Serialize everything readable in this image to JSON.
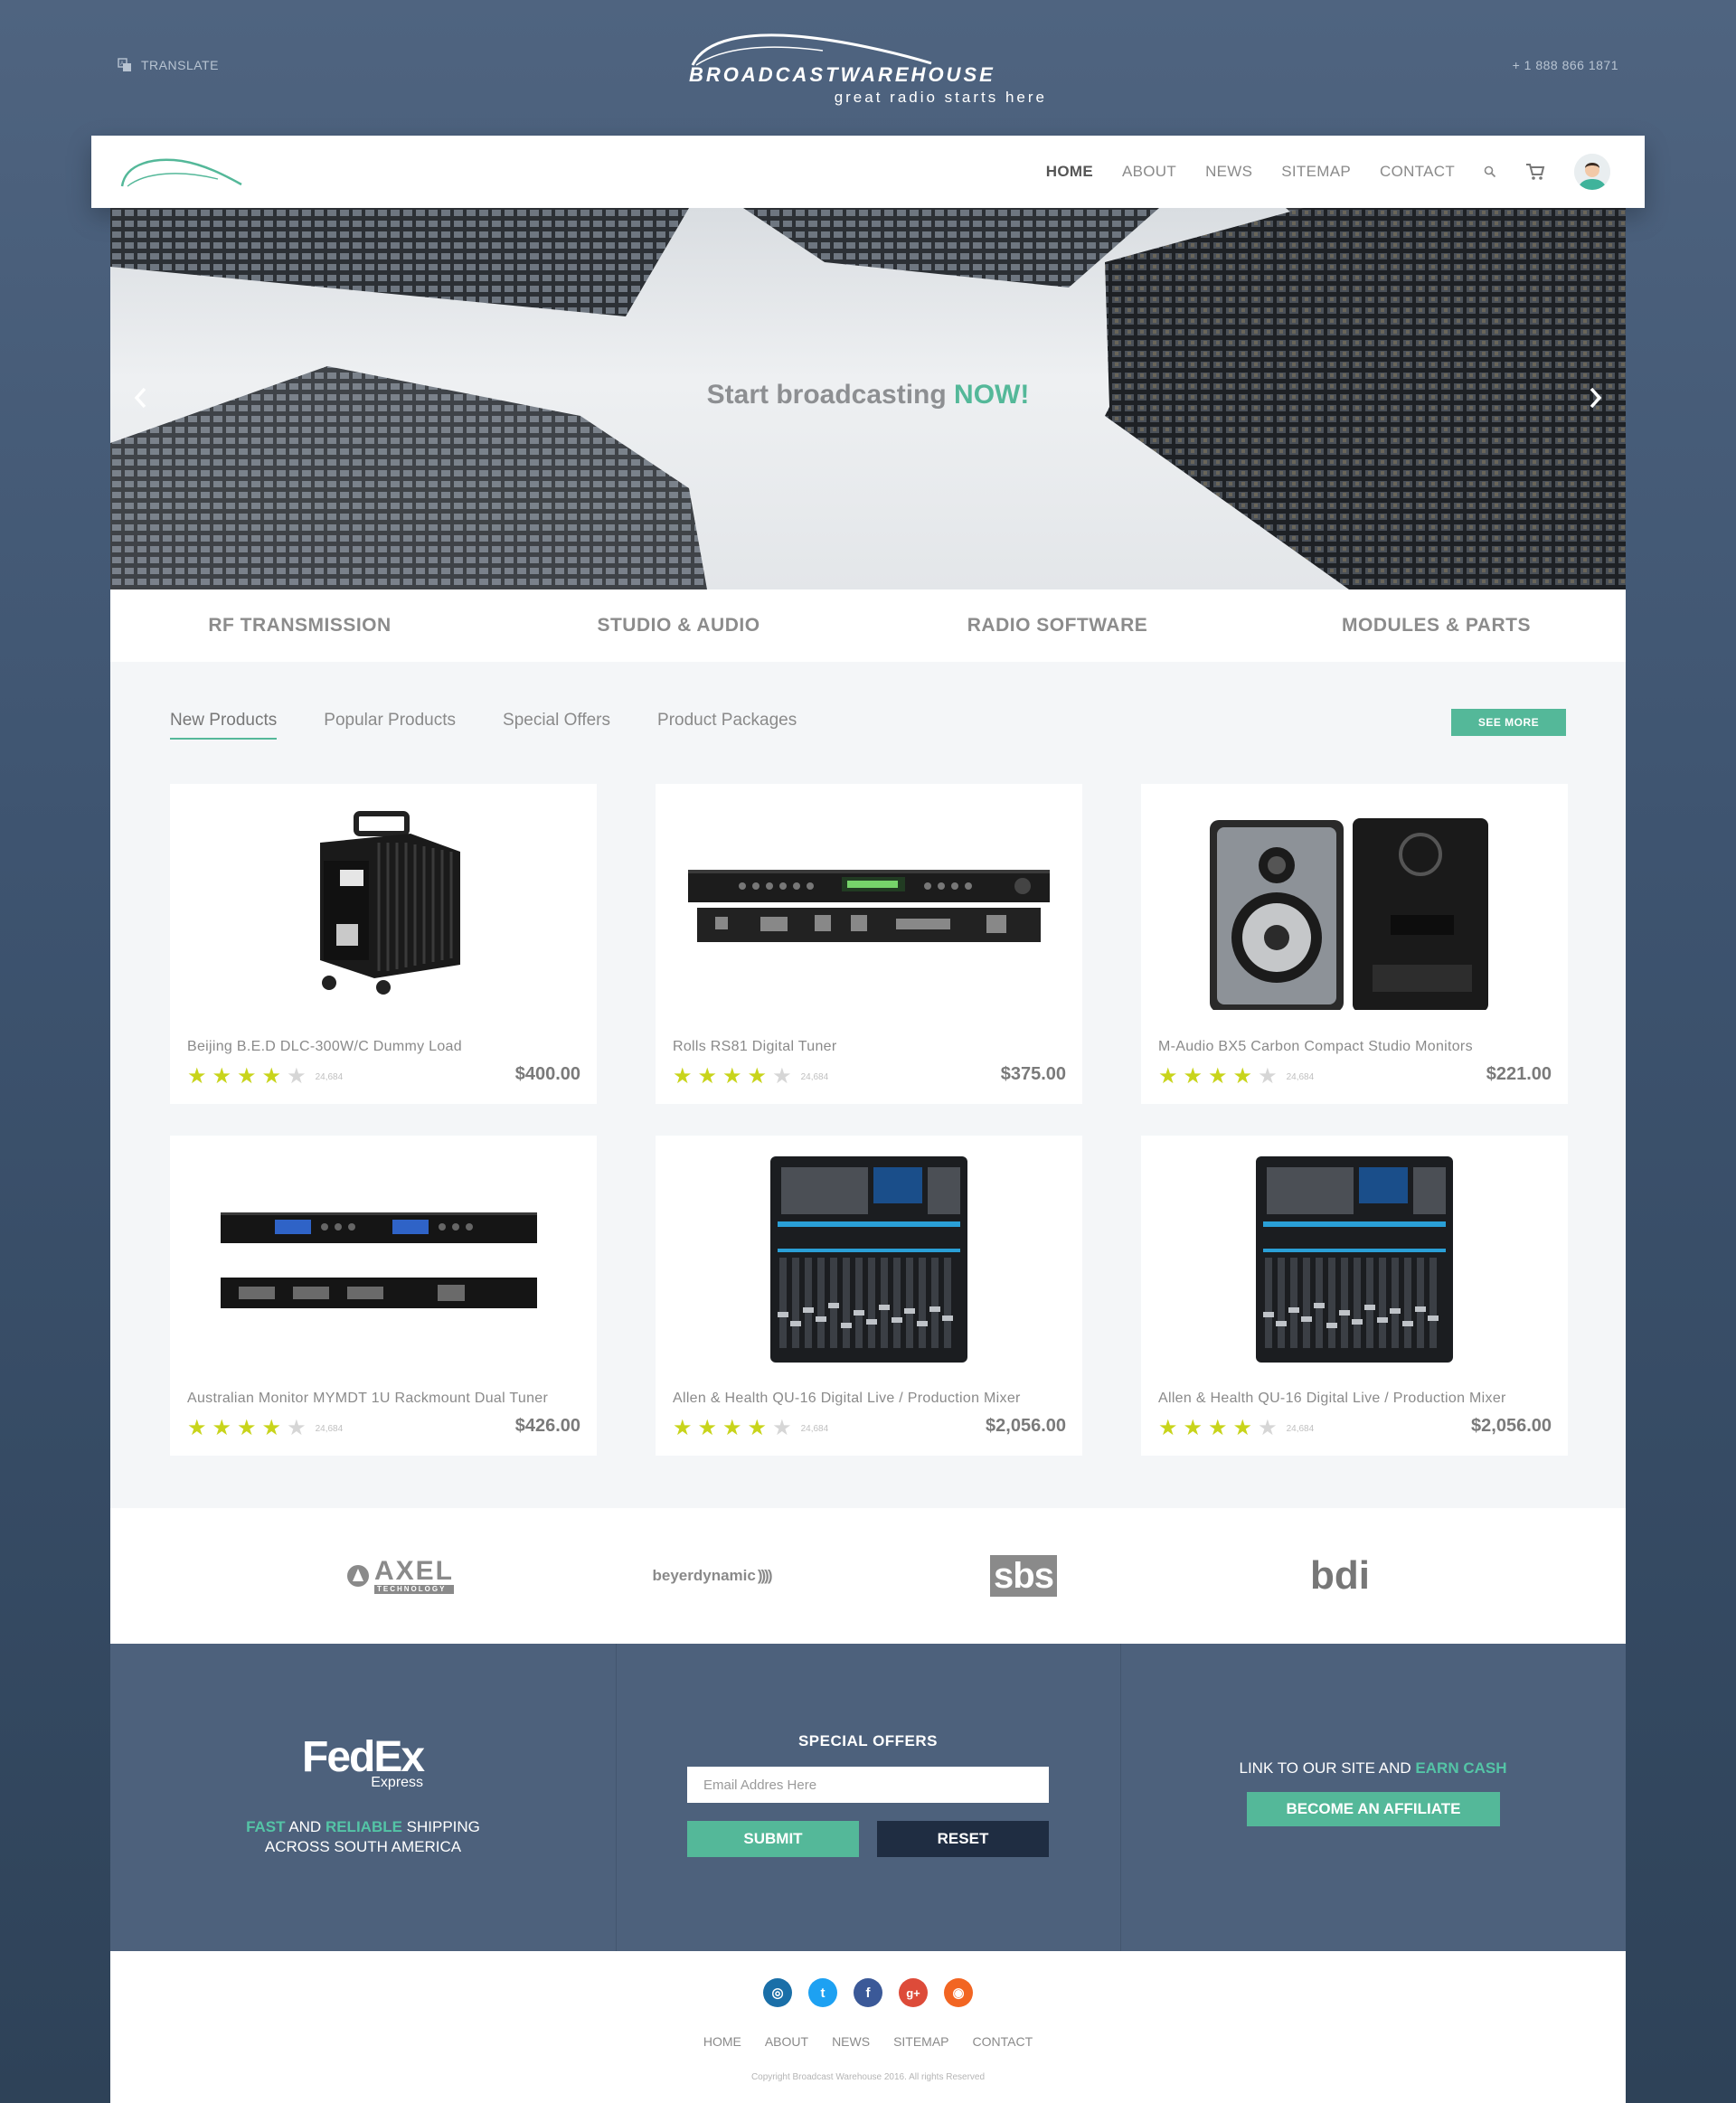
{
  "topbar": {
    "translate_icon": "translate-icon",
    "translate_label": "TRANSLATE",
    "phone": "+ 1 888 866 1871",
    "brand_name": "BROADCASTWAREHOUSE",
    "brand_tagline": "great radio starts here"
  },
  "nav": {
    "items": [
      {
        "label": "HOME",
        "active": true
      },
      {
        "label": "ABOUT",
        "active": false
      },
      {
        "label": "NEWS",
        "active": false
      },
      {
        "label": "SITEMAP",
        "active": false
      },
      {
        "label": "CONTACT",
        "active": false
      }
    ],
    "search_icon": "search-icon",
    "cart_icon": "cart-icon",
    "avatar_icon": "user-avatar"
  },
  "hero": {
    "title_prefix": "Start broadcasting ",
    "title_accent": "NOW!",
    "prev_icon": "chevron-left-icon",
    "next_icon": "chevron-right-icon"
  },
  "categories": [
    "RF TRANSMISSION",
    "STUDIO & AUDIO",
    "RADIO SOFTWARE",
    "MODULES & PARTS"
  ],
  "products_section": {
    "tabs": [
      "New Products",
      "Popular Products",
      "Special Offers",
      "Product Packages"
    ],
    "active_tab": "New Products",
    "see_more_label": "SEE MORE"
  },
  "products": [
    {
      "name": "Beijing B.E.D DLC-300W/C Dummy Load",
      "price": "$400.00",
      "rating": 4,
      "reviews": "24,684",
      "image": "dummy-load"
    },
    {
      "name": "Rolls RS81 Digital Tuner",
      "price": "$375.00",
      "rating": 4,
      "reviews": "24,684",
      "image": "rack-tuner"
    },
    {
      "name": "M-Audio BX5 Carbon Compact Studio Monitors",
      "price": "$221.00",
      "rating": 4,
      "reviews": "24,684",
      "image": "studio-monitors"
    },
    {
      "name": "Australian Monitor MYMDT 1U Rackmount Dual Tuner",
      "price": "$426.00",
      "rating": 4,
      "reviews": "24,684",
      "image": "rack-dual-tuner"
    },
    {
      "name": "Allen & Health QU-16 Digital Live / Production Mixer",
      "price": "$2,056.00",
      "rating": 4,
      "reviews": "24,684",
      "image": "mixer"
    },
    {
      "name": "Allen & Health QU-16 Digital Live / Production Mixer",
      "price": "$2,056.00",
      "rating": 4,
      "reviews": "24,684",
      "image": "mixer"
    }
  ],
  "brands": [
    {
      "name": "AXEL",
      "sub": "TECHNOLOGY"
    },
    {
      "name": "beyerdynamic",
      "sub": ""
    },
    {
      "name": "sbs",
      "sub": ""
    },
    {
      "name": "bdi",
      "sub": ""
    }
  ],
  "footer": {
    "fedex_logo": "FedEx",
    "fedex_sub": "Express",
    "shipping_fast": "FAST",
    "shipping_and": " AND ",
    "shipping_reliable": "RELIABLE",
    "shipping_rest": " SHIPPING",
    "shipping_line2": "ACROSS SOUTH AMERICA",
    "offers_title": "SPECIAL OFFERS",
    "email_placeholder": "Email Addres Here",
    "submit_label": "SUBMIT",
    "reset_label": "RESET",
    "affiliate_text": "LINK TO OUR SITE AND ",
    "affiliate_accent": "EARN CASH",
    "affiliate_button": "BECOME AN AFFILIATE"
  },
  "bottom": {
    "social": [
      {
        "icon": "instagram-icon",
        "color": "#1a6fa8",
        "glyph": "◎"
      },
      {
        "icon": "twitter-icon",
        "color": "#1da1f2",
        "glyph": "t"
      },
      {
        "icon": "facebook-icon",
        "color": "#3b5998",
        "glyph": "f"
      },
      {
        "icon": "googleplus-icon",
        "color": "#dd4b39",
        "glyph": "g+"
      },
      {
        "icon": "rss-icon",
        "color": "#f26522",
        "glyph": "◉"
      }
    ],
    "nav": [
      "HOME",
      "ABOUT",
      "NEWS",
      "SITEMAP",
      "CONTACT"
    ],
    "copyright": "Copyright Broadcast Warehouse 2016. All rights Reserved"
  },
  "colors": {
    "accent": "#54b899",
    "dark_button": "#1f2d42",
    "footer_bg": "#4d617c",
    "star": "#c8d41b"
  }
}
